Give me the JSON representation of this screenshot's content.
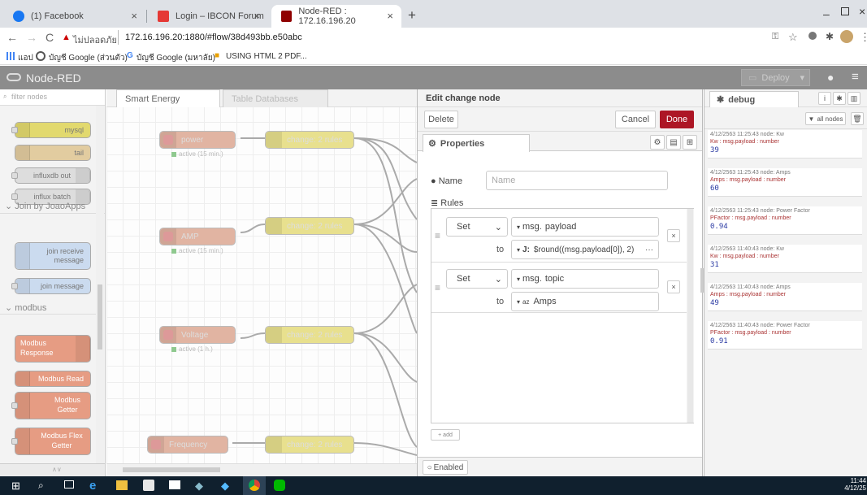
{
  "browser": {
    "tabs": [
      {
        "title": "(1) Facebook",
        "color": "#1877f2"
      },
      {
        "title": "Login – IBCON Forum",
        "color": "#e53935"
      },
      {
        "title": "Node-RED : 172.16.196.20",
        "color": "#8f0000"
      }
    ],
    "new_tab": "+",
    "close": "×",
    "url_warning": "ไม่ปลอดภัย",
    "url": "172.16.196.20:1880/#flow/38d493bb.e50abc",
    "bookmarks": [
      "แอป",
      "บัญชี Google (ส่วนตัว)",
      "บัญชี Google (มหาลัย)",
      "USING HTML 2 PDF..."
    ]
  },
  "header": {
    "app_title": "Node-RED",
    "deploy": "Deploy"
  },
  "palette": {
    "filter_placeholder": "filter nodes",
    "nodes_top": [
      "mysql",
      "tail",
      "influxdb out",
      "influx batch"
    ],
    "category1": "Join by JoaoApps",
    "join_nodes": [
      "join receive message",
      "join message"
    ],
    "category2": "modbus",
    "modbus_nodes": [
      "Modbus Response",
      "Modbus Read",
      "Modbus Getter",
      "Modbus Flex Getter"
    ]
  },
  "workspace": {
    "tabs": [
      "Smart Energy",
      "Table Databases"
    ],
    "inject_nodes": [
      {
        "label": "power",
        "status": "active (15 min.)"
      },
      {
        "label": "AMP",
        "status": "active (15 min.)"
      },
      {
        "label": "Voltage",
        "status": "active (1 h.)"
      },
      {
        "label": "Frequency",
        "status": ""
      }
    ],
    "change_label": "change: 2 rules"
  },
  "tray": {
    "title": "Edit change node",
    "delete": "Delete",
    "cancel": "Cancel",
    "done": "Done",
    "properties_tab": "Properties",
    "name_label": "Name",
    "name_placeholder": "Name",
    "rules_label": "Rules",
    "rules": [
      {
        "action": "Set",
        "target_prefix": "msg.",
        "target": "payload",
        "to": "to",
        "value": "$round((msg.payload[0]), 2)",
        "value_icon": "J:"
      },
      {
        "action": "Set",
        "target_prefix": "msg.",
        "target": "topic",
        "to": "to",
        "value": "Amps",
        "value_icon": "az"
      }
    ],
    "add": "+ add",
    "enabled": "Enabled"
  },
  "sidebar": {
    "tab": "debug",
    "filter": "all nodes",
    "messages": [
      {
        "header": "4/12/2563 11:25:43  node: Kw",
        "topic": "Kw : msg.payload : number",
        "value": "39"
      },
      {
        "header": "4/12/2563 11:25:43  node: Amps",
        "topic": "Amps : msg.payload : number",
        "value": "60"
      },
      {
        "header": "4/12/2563 11:25:43  node: Power Factor",
        "topic": "PFactor : msg.payload : number",
        "value": "0.94"
      },
      {
        "header": "4/12/2563 11:40:43  node: Kw",
        "topic": "Kw : msg.payload : number",
        "value": "31"
      },
      {
        "header": "4/12/2563 11:40:43  node: Amps",
        "topic": "Amps : msg.payload : number",
        "value": "49"
      },
      {
        "header": "4/12/2563 11:40:43  node: Power Factor",
        "topic": "PFactor : msg.payload : number",
        "value": "0.91"
      }
    ]
  },
  "taskbar": {
    "time": "11:44",
    "date": "4/12/25"
  }
}
